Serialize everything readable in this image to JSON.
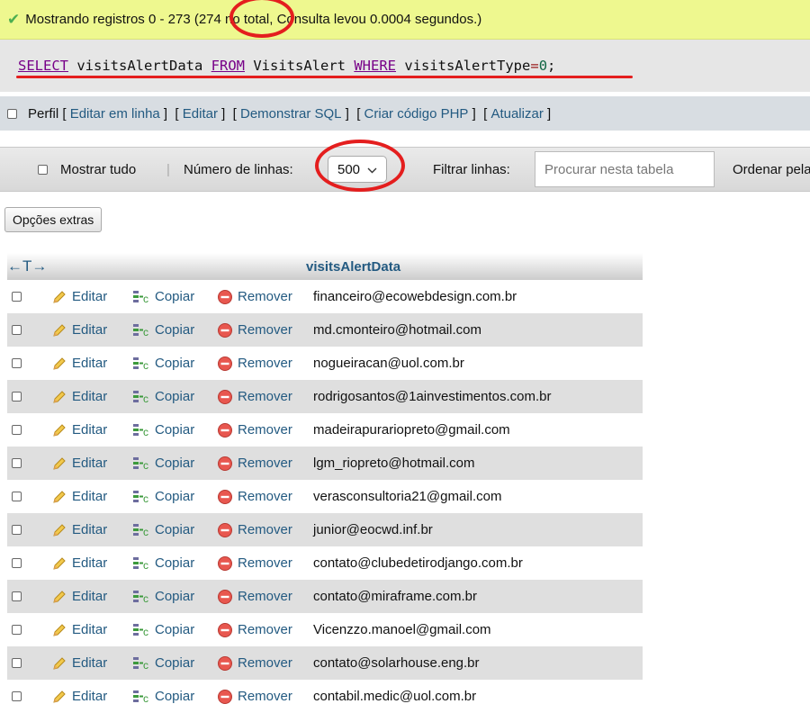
{
  "success": {
    "text": "Mostrando registros 0 - 273 (274 no total, Consulta levou 0.0004 segundos.)"
  },
  "sql": {
    "select_kw": "SELECT",
    "column": "visitsAlertData",
    "from_kw": "FROM",
    "table": "VisitsAlert",
    "where_kw": "WHERE",
    "field": "visitsAlertType",
    "operator": "=",
    "value": "0",
    "terminator": ";"
  },
  "profile": {
    "label": "Perfil",
    "links": [
      "Editar em linha",
      "Editar",
      "Demonstrar SQL",
      "Criar código PHP",
      "Atualizar"
    ]
  },
  "nav": {
    "show_all": "Mostrar tudo",
    "rows_label": "Número de linhas:",
    "rows_value": "500",
    "filter_label": "Filtrar linhas:",
    "filter_placeholder": "Procurar nesta tabela",
    "sort_label": "Ordenar pela"
  },
  "extras_button": "Opções extras",
  "table": {
    "arrows": "←T→",
    "column_header": "visitsAlertData",
    "edit_label": "Editar",
    "copy_label": "Copiar",
    "delete_label": "Remover",
    "rows": [
      "financeiro@ecowebdesign.com.br",
      "md.cmonteiro@hotmail.com",
      "nogueiracan@uol.com.br",
      "rodrigosantos@1ainvestimentos.com.br",
      "madeirapurariopreto@gmail.com",
      "lgm_riopreto@hotmail.com",
      "verasconsultoria21@gmail.com",
      "junior@eocwd.inf.br",
      "contato@clubedetirodjango.com.br",
      "contato@miraframe.com.br",
      "Vicenzzo.manoel@gmail.com",
      "contato@solarhouse.eng.br",
      "contabil.medic@uol.com.br"
    ]
  },
  "colors": {
    "link": "#235a81",
    "success_bg": "#eef88f",
    "annotation": "#e41e1e"
  }
}
